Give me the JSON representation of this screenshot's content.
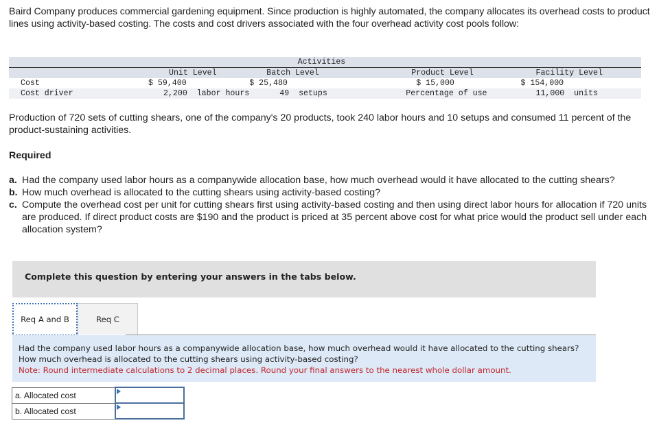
{
  "intro": "Baird Company produces commercial gardening equipment. Since production is highly automated, the company allocates its overhead costs to product lines using activity-based costing. The costs and cost drivers associated with the four overhead activity cost pools follow:",
  "activity_table": {
    "group_header": "Activities",
    "columns": [
      "Unit Level",
      "Batch Level",
      "Product Level",
      "Facility Level"
    ],
    "rows": [
      {
        "label": "Cost",
        "values": [
          "$ 59,400",
          "$ 25,480",
          "$ 15,000",
          "$ 154,000"
        ]
      },
      {
        "label": "Cost driver",
        "values": [
          "2,200  labor hours",
          "49  setups",
          "Percentage of use",
          "11,000  units"
        ]
      }
    ]
  },
  "production_paragraph": "Production of 720 sets of cutting shears, one of the company's 20 products, took 240 labor hours and 10 setups and consumed 11 percent of the product-sustaining activities.",
  "required_heading": "Required",
  "requirements": [
    {
      "letter": "a.",
      "text": "Had the company used labor hours as a companywide allocation base, how much overhead would it have allocated to the cutting shears?"
    },
    {
      "letter": "b.",
      "text": "How much overhead is allocated to the cutting shears using activity-based costing?"
    },
    {
      "letter": "c.",
      "text": "Compute the overhead cost per unit for cutting shears first using activity-based costing and then using direct labor hours for allocation if 720 units are produced. If direct product costs are $190 and the product is priced at 35 percent above cost for what price would the product sell under each allocation system?"
    }
  ],
  "banner": "Complete this question by entering your answers in the tabs below.",
  "tabs": [
    {
      "label": "Req A and B",
      "active": true
    },
    {
      "label": "Req C",
      "active": false
    }
  ],
  "question_panel": {
    "question": "Had the company used labor hours as a companywide allocation base, how much overhead would it have allocated to the cutting shears? How much overhead is allocated to the cutting shears using activity-based costing?",
    "note": "Note: Round intermediate calculations to 2 decimal places. Round your final answers to the nearest whole dollar amount."
  },
  "answers": [
    {
      "label": "a. Allocated cost",
      "value": ""
    },
    {
      "label": "b. Allocated cost",
      "value": ""
    }
  ]
}
